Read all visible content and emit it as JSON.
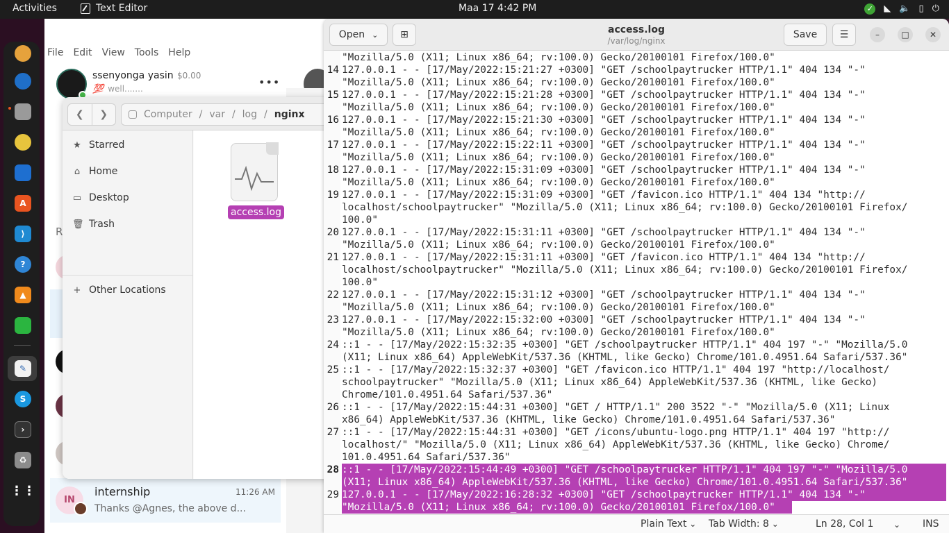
{
  "topbar": {
    "activities": "Activities",
    "app_name": "Text Editor",
    "clock": "Maa 17  4:42 PM"
  },
  "background_app": {
    "menu": [
      "File",
      "Edit",
      "View",
      "Tools",
      "Help"
    ],
    "profile_name": "ssenyonga yasin",
    "balance": "$0.00",
    "mood_emoji": "💯",
    "mood_text": "well.......",
    "partial_letter": "R",
    "chat": {
      "initials": "IN",
      "name": "internship",
      "time": "11:26 AM",
      "message": "Thanks @Agnes, the above d..."
    }
  },
  "files": {
    "path": [
      "Computer",
      "var",
      "log",
      "nginx"
    ],
    "sidebar": [
      "Starred",
      "Home",
      "Desktop",
      "Trash"
    ],
    "other_locations": "Other Locations",
    "file_name": "access.log"
  },
  "editor": {
    "open_label": "Open",
    "save_label": "Save",
    "title": "access.log",
    "subtitle": "/var/log/nginx",
    "lines": [
      {
        "n": "",
        "text": "\"Mozilla/5.0 (X11; Linux x86_64; rv:100.0) Gecko/20100101 Firefox/100.0\""
      },
      {
        "n": "14",
        "text": "127.0.0.1 - - [17/May/2022:15:21:27 +0300] \"GET /schoolpaytrucker HTTP/1.1\" 404 134 \"-\""
      },
      {
        "n": "",
        "text": "\"Mozilla/5.0 (X11; Linux x86_64; rv:100.0) Gecko/20100101 Firefox/100.0\""
      },
      {
        "n": "15",
        "text": "127.0.0.1 - - [17/May/2022:15:21:28 +0300] \"GET /schoolpaytrucker HTTP/1.1\" 404 134 \"-\""
      },
      {
        "n": "",
        "text": "\"Mozilla/5.0 (X11; Linux x86_64; rv:100.0) Gecko/20100101 Firefox/100.0\""
      },
      {
        "n": "16",
        "text": "127.0.0.1 - - [17/May/2022:15:21:30 +0300] \"GET /schoolpaytrucker HTTP/1.1\" 404 134 \"-\""
      },
      {
        "n": "",
        "text": "\"Mozilla/5.0 (X11; Linux x86_64; rv:100.0) Gecko/20100101 Firefox/100.0\""
      },
      {
        "n": "17",
        "text": "127.0.0.1 - - [17/May/2022:15:22:11 +0300] \"GET /schoolpaytrucker HTTP/1.1\" 404 134 \"-\""
      },
      {
        "n": "",
        "text": "\"Mozilla/5.0 (X11; Linux x86_64; rv:100.0) Gecko/20100101 Firefox/100.0\""
      },
      {
        "n": "18",
        "text": "127.0.0.1 - - [17/May/2022:15:31:09 +0300] \"GET /schoolpaytrucker HTTP/1.1\" 404 134 \"-\""
      },
      {
        "n": "",
        "text": "\"Mozilla/5.0 (X11; Linux x86_64; rv:100.0) Gecko/20100101 Firefox/100.0\""
      },
      {
        "n": "19",
        "text": "127.0.0.1 - - [17/May/2022:15:31:09 +0300] \"GET /favicon.ico HTTP/1.1\" 404 134 \"http://"
      },
      {
        "n": "",
        "text": "localhost/schoolpaytrucker\" \"Mozilla/5.0 (X11; Linux x86_64; rv:100.0) Gecko/20100101 Firefox/"
      },
      {
        "n": "",
        "text": "100.0\""
      },
      {
        "n": "20",
        "text": "127.0.0.1 - - [17/May/2022:15:31:11 +0300] \"GET /schoolpaytrucker HTTP/1.1\" 404 134 \"-\""
      },
      {
        "n": "",
        "text": "\"Mozilla/5.0 (X11; Linux x86_64; rv:100.0) Gecko/20100101 Firefox/100.0\""
      },
      {
        "n": "21",
        "text": "127.0.0.1 - - [17/May/2022:15:31:11 +0300] \"GET /favicon.ico HTTP/1.1\" 404 134 \"http://"
      },
      {
        "n": "",
        "text": "localhost/schoolpaytrucker\" \"Mozilla/5.0 (X11; Linux x86_64; rv:100.0) Gecko/20100101 Firefox/"
      },
      {
        "n": "",
        "text": "100.0\""
      },
      {
        "n": "22",
        "text": "127.0.0.1 - - [17/May/2022:15:31:12 +0300] \"GET /schoolpaytrucker HTTP/1.1\" 404 134 \"-\""
      },
      {
        "n": "",
        "text": "\"Mozilla/5.0 (X11; Linux x86_64; rv:100.0) Gecko/20100101 Firefox/100.0\""
      },
      {
        "n": "23",
        "text": "127.0.0.1 - - [17/May/2022:15:32:00 +0300] \"GET /schoolpaytrucker HTTP/1.1\" 404 134 \"-\""
      },
      {
        "n": "",
        "text": "\"Mozilla/5.0 (X11; Linux x86_64; rv:100.0) Gecko/20100101 Firefox/100.0\""
      },
      {
        "n": "24",
        "text": "::1 - - [17/May/2022:15:32:35 +0300] \"GET /schoolpaytrucker HTTP/1.1\" 404 197 \"-\" \"Mozilla/5.0"
      },
      {
        "n": "",
        "text": "(X11; Linux x86_64) AppleWebKit/537.36 (KHTML, like Gecko) Chrome/101.0.4951.64 Safari/537.36\""
      },
      {
        "n": "25",
        "text": "::1 - - [17/May/2022:15:32:37 +0300] \"GET /favicon.ico HTTP/1.1\" 404 197 \"http://localhost/"
      },
      {
        "n": "",
        "text": "schoolpaytrucker\" \"Mozilla/5.0 (X11; Linux x86_64) AppleWebKit/537.36 (KHTML, like Gecko)"
      },
      {
        "n": "",
        "text": "Chrome/101.0.4951.64 Safari/537.36\""
      },
      {
        "n": "26",
        "text": "::1 - - [17/May/2022:15:44:31 +0300] \"GET / HTTP/1.1\" 200 3522 \"-\" \"Mozilla/5.0 (X11; Linux"
      },
      {
        "n": "",
        "text": "x86_64) AppleWebKit/537.36 (KHTML, like Gecko) Chrome/101.0.4951.64 Safari/537.36\""
      },
      {
        "n": "27",
        "text": "::1 - - [17/May/2022:15:44:31 +0300] \"GET /icons/ubuntu-logo.png HTTP/1.1\" 404 197 \"http://"
      },
      {
        "n": "",
        "text": "localhost/\" \"Mozilla/5.0 (X11; Linux x86_64) AppleWebKit/537.36 (KHTML, like Gecko) Chrome/"
      },
      {
        "n": "",
        "text": "101.0.4951.64 Safari/537.36\""
      },
      {
        "n": "28",
        "text": "::1 - - [17/May/2022:15:44:49 +0300] \"GET /schoolpaytrucker HTTP/1.1\" 404 197 \"-\" \"Mozilla/5.0",
        "selected": true,
        "current": true
      },
      {
        "n": "",
        "text": "(X11; Linux x86_64) AppleWebKit/537.36 (KHTML, like Gecko) Chrome/101.0.4951.64 Safari/537.36\"",
        "selected": true
      },
      {
        "n": "29",
        "text": "127.0.0.1 - - [17/May/2022:16:28:32 +0300] \"GET /schoolpaytrucker HTTP/1.1\" 404 134 \"-\"",
        "selected": true
      },
      {
        "n": "",
        "text": "\"Mozilla/5.0 (X11; Linux x86_64; rv:100.0) Gecko/20100101 Firefox/100.0\"",
        "selected": true,
        "partial": true
      }
    ],
    "status": {
      "language": "Plain Text",
      "tab_width": "Tab Width: 8",
      "position": "Ln 28, Col 1",
      "mode": "INS"
    }
  }
}
